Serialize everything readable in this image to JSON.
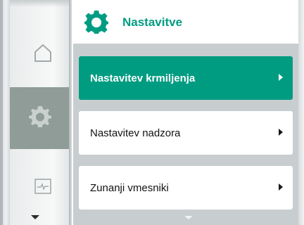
{
  "header": {
    "title": "Nastavitve",
    "icon": "gear-icon",
    "accent_color": "#009c82"
  },
  "sidebar": {
    "items": [
      {
        "name": "home",
        "icon": "home-icon",
        "active": false
      },
      {
        "name": "settings",
        "icon": "gear-icon",
        "active": true
      },
      {
        "name": "diagnostics",
        "icon": "pulse-graph-icon",
        "active": false
      }
    ],
    "scroll_indicator": "chevron-down-icon"
  },
  "menu": {
    "items": [
      {
        "label": "Nastavitev krmiljenja",
        "active": true
      },
      {
        "label": "Nastavitev nadzora",
        "active": false
      },
      {
        "label": "Zunanji vmesniki",
        "active": false
      }
    ],
    "scroll_indicator": "chevron-down-icon"
  }
}
